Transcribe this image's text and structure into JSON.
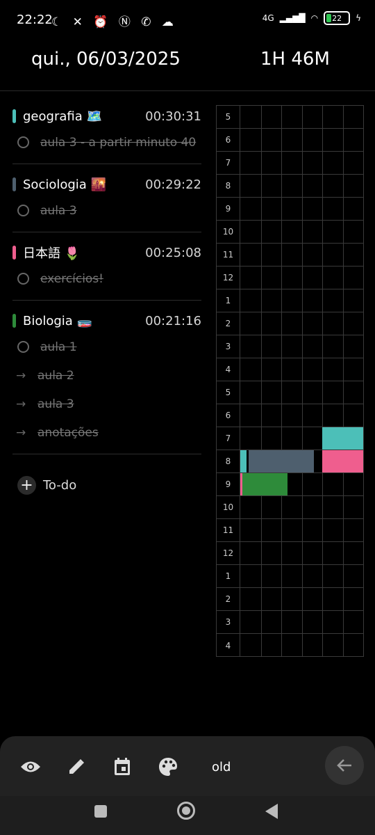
{
  "status": {
    "time": "22:22",
    "left_icons": "☾ ✕ ⏰ Ⓝ ✆ ☁",
    "network": "4G",
    "battery": "22"
  },
  "header": {
    "date": "qui., 06/03/2025",
    "total": "1H 46M"
  },
  "groups": [
    {
      "name": "geografia 🗺️",
      "time": "00:30:31",
      "color": "#4cbfb8",
      "items": [
        {
          "text": "aula 3 - a partir minuto 40",
          "icon": "circle"
        }
      ]
    },
    {
      "name": "Sociologia 🌇",
      "time": "00:29:22",
      "color": "#4e5f6e",
      "items": [
        {
          "text": "aula 3",
          "icon": "circle"
        }
      ]
    },
    {
      "name": "日本語 🌷",
      "time": "00:25:08",
      "color": "#ef5e8e",
      "items": [
        {
          "text": "exercícios!",
          "icon": "circle"
        }
      ]
    },
    {
      "name": "Biologia 🧫",
      "time": "00:21:16",
      "color": "#2e8b3a",
      "items": [
        {
          "text": "aula 1",
          "icon": "circle"
        },
        {
          "text": "aula 2",
          "icon": "arrow"
        },
        {
          "text": "aula 3",
          "icon": "arrow"
        },
        {
          "text": "anotações",
          "icon": "arrow"
        }
      ]
    }
  ],
  "todo_label": "To-do",
  "hours": [
    "5",
    "6",
    "7",
    "8",
    "9",
    "10",
    "11",
    "12",
    "1",
    "2",
    "3",
    "4",
    "5",
    "6",
    "7",
    "8",
    "9",
    "10",
    "11",
    "12",
    "1",
    "2",
    "3",
    "4"
  ],
  "timeline_blocks": [
    {
      "row": 14,
      "from_min": 40,
      "to_min": 60,
      "color": "#4cbfb8"
    },
    {
      "row": 15,
      "from_min": 0,
      "to_min": 3,
      "color": "#4cbfb8"
    },
    {
      "row": 15,
      "from_min": 4,
      "to_min": 36,
      "color": "#4e5f6e"
    },
    {
      "row": 15,
      "from_min": 40,
      "to_min": 60,
      "color": "#ef5e8e"
    },
    {
      "row": 16,
      "from_min": 0,
      "to_min": 1,
      "color": "#ef5e8e"
    },
    {
      "row": 16,
      "from_min": 1,
      "to_min": 23,
      "color": "#2e8b3a"
    }
  ],
  "bottom": {
    "mode_label": "old"
  }
}
